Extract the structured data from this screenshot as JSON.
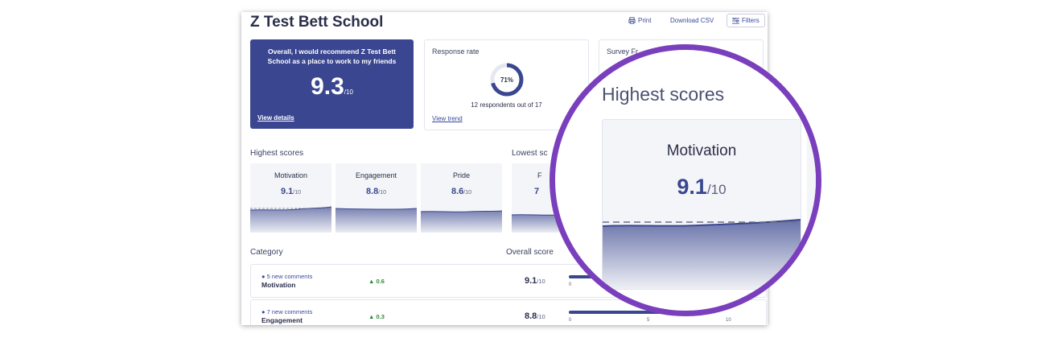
{
  "header": {
    "title": "Z Test Bett School",
    "print": "Print",
    "csv": "Download CSV",
    "filters": "Filters"
  },
  "hero": {
    "question": "Overall, I would recommend Z Test Bett School as a place to work to my friends",
    "score": "9.3",
    "out_of": "/10",
    "link": "View details"
  },
  "response": {
    "label": "Response rate",
    "percent": "71%",
    "percent_value": 0.71,
    "respondents": "12 respondents out of 17",
    "link": "View trend"
  },
  "survey": {
    "label": "Survey Fr"
  },
  "highest": {
    "title": "Highest scores",
    "items": [
      {
        "name": "Motivation",
        "score": "9.1",
        "out": "/10"
      },
      {
        "name": "Engagement",
        "score": "8.8",
        "out": "/10"
      },
      {
        "name": "Pride",
        "score": "8.6",
        "out": "/10"
      }
    ]
  },
  "lowest": {
    "title": "Lowest sc",
    "items": [
      {
        "name": "F",
        "score": "7"
      }
    ]
  },
  "table": {
    "category_header": "Category",
    "score_header": "Overall score",
    "rows": [
      {
        "comments": "5 new comments",
        "name": "Motivation",
        "delta": "0.6",
        "score": "9.1",
        "out": "/10",
        "ticks": [
          "0"
        ]
      },
      {
        "comments": "7 new comments",
        "name": "Engagement",
        "delta": "0.3",
        "score": "8.8",
        "out": "/10",
        "ticks": [
          "0",
          "5",
          "10"
        ]
      }
    ]
  },
  "zoom": {
    "title": "Highest scores",
    "name": "Motivation",
    "score": "9.1",
    "out": "/10"
  },
  "colors": {
    "primary": "#3a4790",
    "accent_ring": "#7a3fbc",
    "positive": "#2f8a3a"
  }
}
